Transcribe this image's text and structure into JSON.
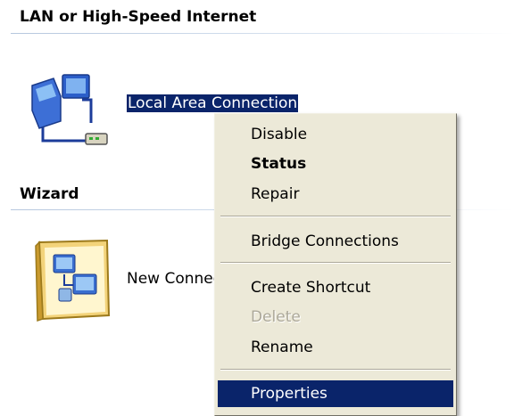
{
  "groups": {
    "lan": {
      "title": "LAN or High-Speed Internet"
    },
    "wizard": {
      "title": "Wizard"
    }
  },
  "items": {
    "local_area_connection": {
      "label": "Local Area Connection",
      "icon": "network-connection-icon"
    },
    "new_connection_wizard": {
      "label": "New Connection Wizard",
      "icon": "new-connection-wizard-icon"
    }
  },
  "context_menu": {
    "items": [
      {
        "label": "Disable"
      },
      {
        "label": "Status"
      },
      {
        "label": "Repair"
      },
      {
        "label": "Bridge Connections"
      },
      {
        "label": "Create Shortcut"
      },
      {
        "label": "Delete"
      },
      {
        "label": "Rename"
      },
      {
        "label": "Properties"
      }
    ]
  },
  "colors": {
    "selection": "#0a246a",
    "menu_background": "#ece9d8",
    "disabled_text": "#aca899"
  }
}
